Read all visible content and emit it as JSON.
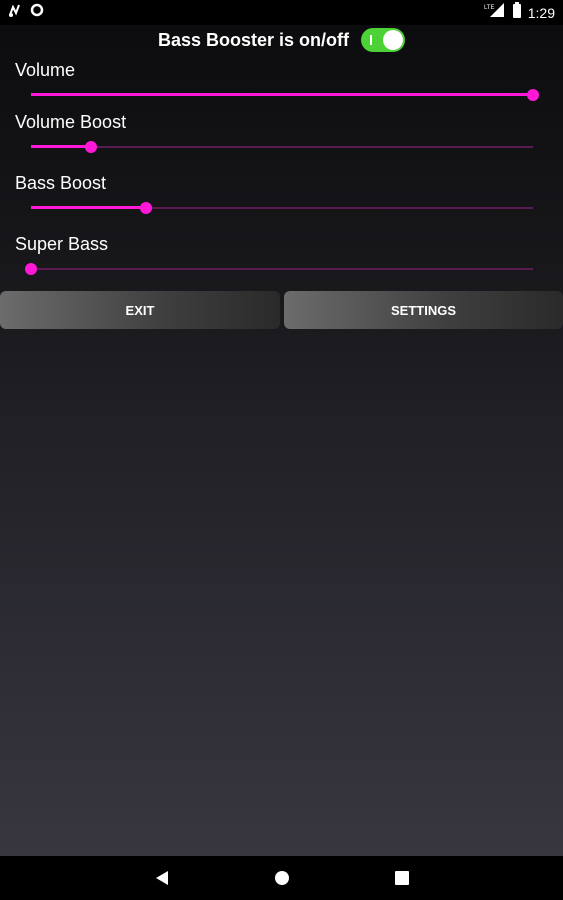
{
  "status_bar": {
    "time": "1:29",
    "left_icons": [
      "music-note-icon",
      "circle-notification-icon"
    ],
    "right_icons": [
      "lte-signal-icon",
      "battery-icon"
    ],
    "network": "LTE"
  },
  "header": {
    "title": "Bass Booster is on/off",
    "toggle_on": true,
    "toggle_color": "#4cd137"
  },
  "sliders": [
    {
      "label": "Volume",
      "value": 1.0
    },
    {
      "label": "Volume Boost",
      "value": 0.12
    },
    {
      "label": "Bass Boost",
      "value": 0.23
    },
    {
      "label": "Super Bass",
      "value": 0.0
    }
  ],
  "accent_color": "#ff18d8",
  "buttons": {
    "exit_label": "EXIT",
    "settings_label": "SETTINGS"
  },
  "nav_bar": {
    "icons": [
      "back-icon",
      "home-icon",
      "recents-icon"
    ]
  }
}
